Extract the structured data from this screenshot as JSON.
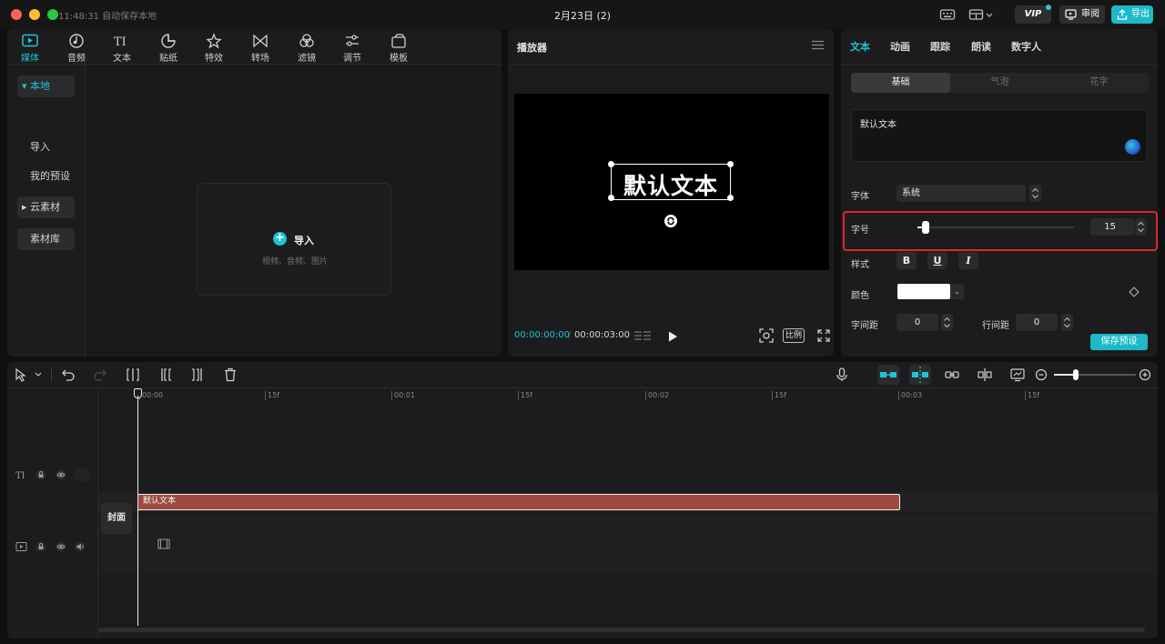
{
  "titlebar": {
    "save_status": "11:48:31 自动保存本地",
    "title": "2月23日 (2)",
    "vip_label": "VIP",
    "review_label": "审阅",
    "export_label": "导出"
  },
  "media": {
    "tabs": [
      {
        "label": "媒体",
        "icon": "media-icon"
      },
      {
        "label": "音频",
        "icon": "audio-icon"
      },
      {
        "label": "文本",
        "icon": "text-icon"
      },
      {
        "label": "贴纸",
        "icon": "sticker-icon"
      },
      {
        "label": "特效",
        "icon": "effects-icon"
      },
      {
        "label": "转场",
        "icon": "transition-icon"
      },
      {
        "label": "滤镜",
        "icon": "filter-icon"
      },
      {
        "label": "调节",
        "icon": "adjust-icon"
      },
      {
        "label": "模板",
        "icon": "template-icon"
      }
    ],
    "sidebar": {
      "local": "本地",
      "import": "导入",
      "my_presets": "我的预设",
      "cloud": "云素材",
      "library": "素材库"
    },
    "import_box": {
      "label": "导入",
      "hint": "视频、音频、图片"
    }
  },
  "player": {
    "title": "播放器",
    "canvas_text": "默认文本",
    "time_current": "00:00:00:00",
    "time_total": "00:00:03:00",
    "ratio_label": "比例"
  },
  "props": {
    "tabs": [
      "文本",
      "动画",
      "跟踪",
      "朗读",
      "数字人"
    ],
    "segments": [
      "基础",
      "气泡",
      "花字"
    ],
    "text_value": "默认文本",
    "font_label": "字体",
    "font_value": "系统",
    "size_label": "字号",
    "size_value": "15",
    "size_level": 0.05,
    "style_label": "样式",
    "style_buttons": [
      "B",
      "U",
      "I"
    ],
    "color_label": "颜色",
    "color_value": "#ffffff",
    "letter_spacing_label": "字间距",
    "letter_spacing_value": "0",
    "line_spacing_label": "行间距",
    "line_spacing_value": "0",
    "save_preset_label": "保存预设"
  },
  "timeline": {
    "ruler": [
      "00:00",
      "15f",
      "00:01",
      "15f",
      "00:02",
      "15f",
      "00:03",
      "15f"
    ],
    "text_clip_label": "默认文本",
    "cover_label": "封面",
    "zoom_level": 0.27
  },
  "colors": {
    "accent": "#1fc4d6",
    "text_clip": "#9e4a42",
    "highlight": "#e0262b"
  }
}
